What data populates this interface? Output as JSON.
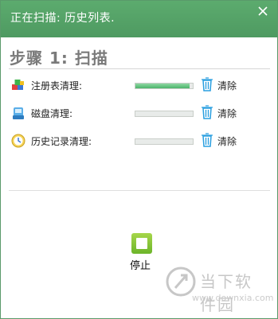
{
  "window": {
    "title": "正在扫描: 历史列表.",
    "close_glyph": "×"
  },
  "step": {
    "title": "步骤 1: 扫描"
  },
  "rows": [
    {
      "label": "注册表清理:",
      "progress": 0.95,
      "action_label": "清除",
      "icon": "registry-cubes-icon"
    },
    {
      "label": "磁盘清理:",
      "progress": 0.0,
      "action_label": "清除",
      "icon": "disk-icon"
    },
    {
      "label": "历史记录清理:",
      "progress": 0.0,
      "action_label": "清除",
      "icon": "history-clock-icon"
    }
  ],
  "stop": {
    "label": "停止",
    "icon": "stop-square-icon"
  },
  "watermark": {
    "name": "当下软件园",
    "url": "www.downxia.com"
  },
  "colors": {
    "titlebar": "#55a468",
    "progress": "#5bbf7a",
    "trash": "#2a9fe0",
    "stop": "#8cc63f"
  }
}
